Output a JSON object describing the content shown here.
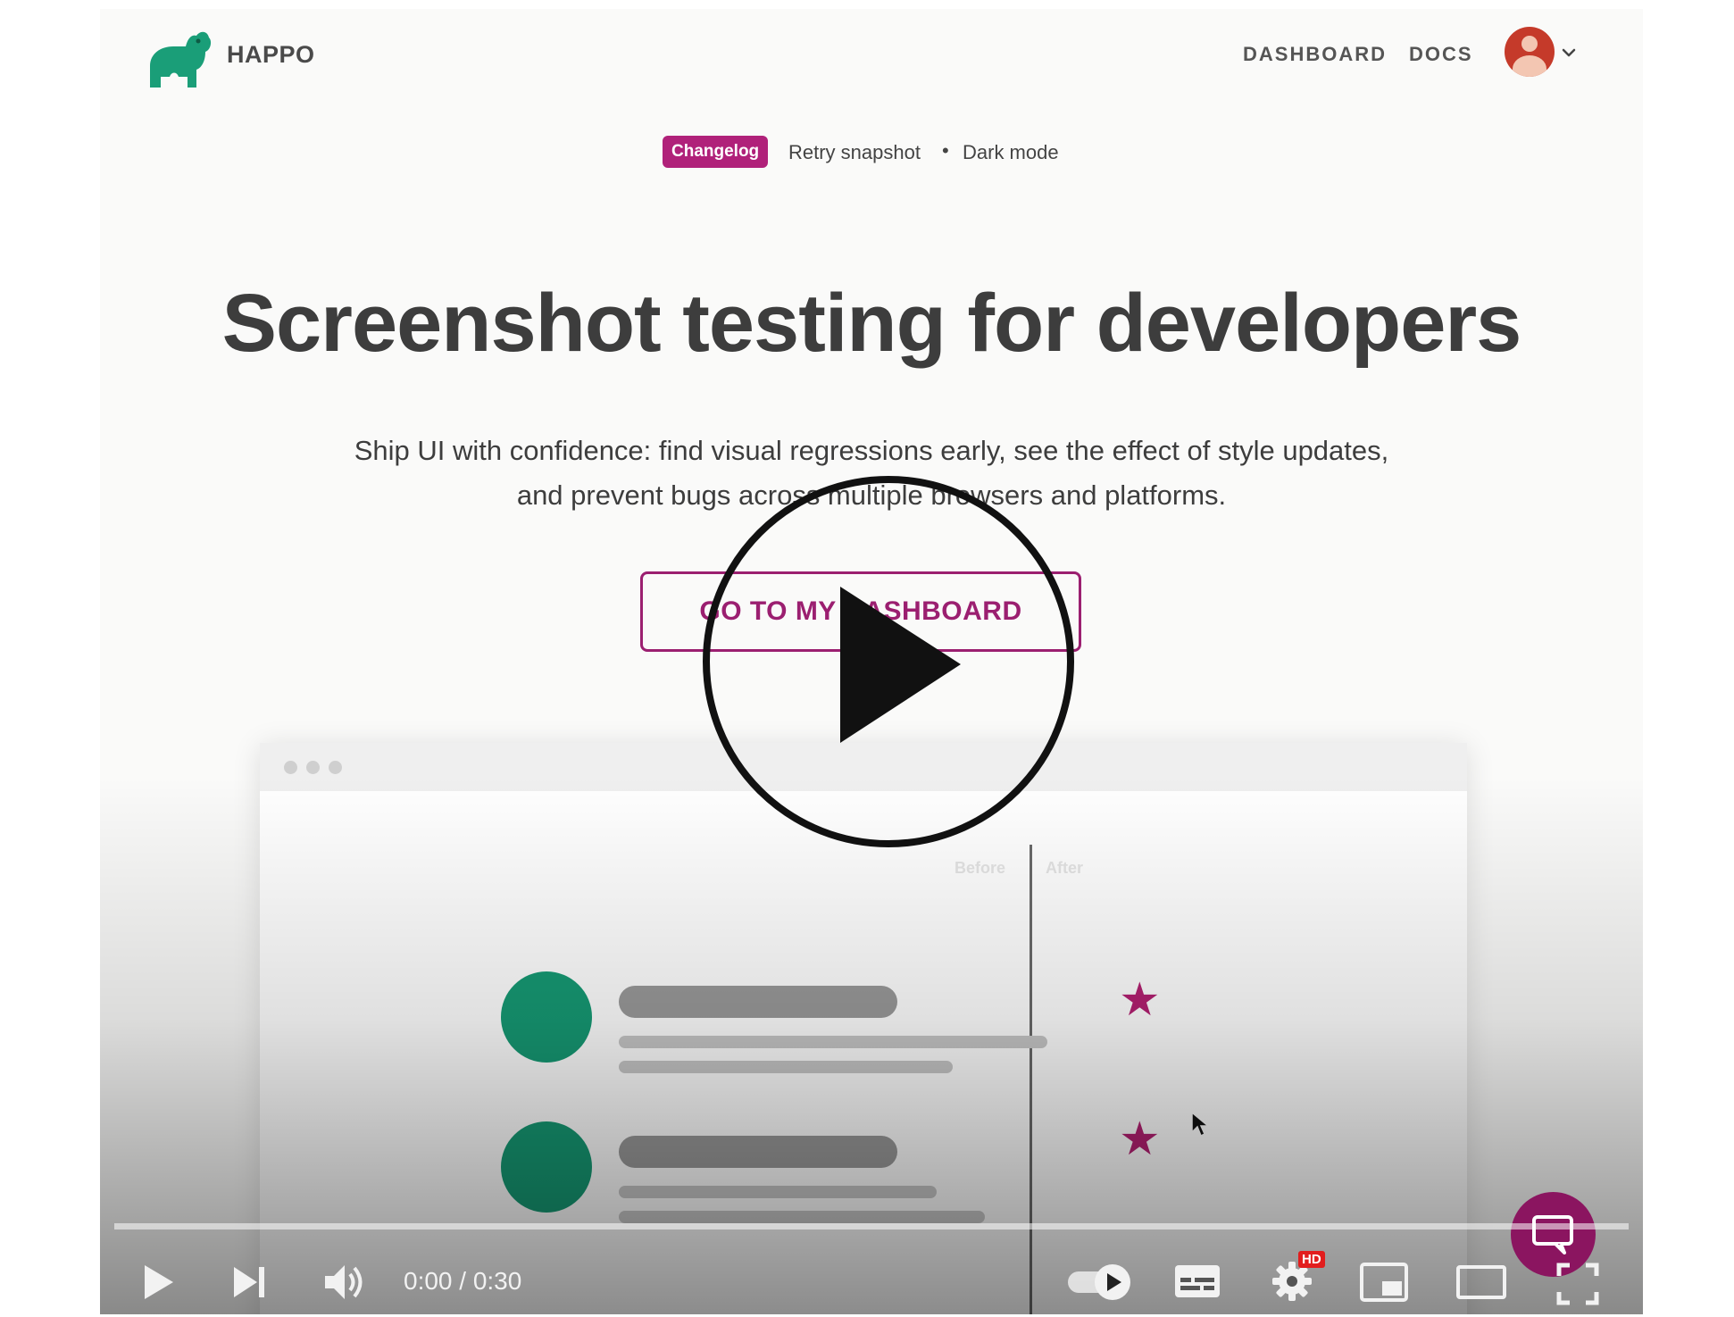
{
  "header": {
    "brand": "HAPPO",
    "nav": {
      "dashboard": "DASHBOARD",
      "docs": "DOCS"
    },
    "avatar_caret": "⌄"
  },
  "changelog": {
    "badge": "Changelog",
    "items": [
      "Retry snapshot",
      "Dark mode"
    ],
    "separator": "•"
  },
  "hero": {
    "title": "Screenshot testing for developers",
    "subtitle_line1": "Ship UI with confidence: find visual regressions early, see the effect of style updates,",
    "subtitle_line2": "and prevent bugs across multiple browsers and platforms.",
    "cta": "GO TO MY DASHBOARD"
  },
  "illustration": {
    "before_label": "Before",
    "after_label": "After"
  },
  "colors": {
    "brand_teal": "#169a74",
    "accent_magenta": "#b0217a",
    "chat_bubble": "#8b1560"
  },
  "player": {
    "time": "0:00 / 0:30",
    "hd_badge": "HD",
    "progress": 0
  },
  "icons": {
    "logo": "hippo-logo-icon",
    "big_play": "play-circle-icon",
    "play": "play-icon",
    "next": "skip-next-icon",
    "volume": "volume-icon",
    "autoplay": "autoplay-toggle-icon",
    "subtitles": "subtitles-icon",
    "settings": "gear-icon",
    "miniplayer": "miniplayer-icon",
    "theater": "theater-mode-icon",
    "fullscreen": "fullscreen-icon",
    "chat": "chat-icon"
  }
}
